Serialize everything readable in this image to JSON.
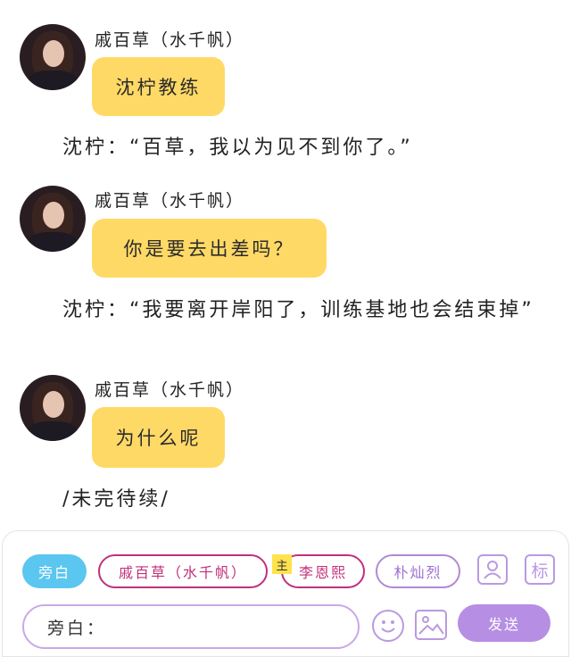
{
  "messages": [
    {
      "type": "chat",
      "speaker": "戚百草（水千帆）",
      "text": "沈柠教练"
    },
    {
      "type": "narration",
      "text": "沈柠：“百草，我以为见不到你了。”"
    },
    {
      "type": "chat",
      "speaker": "戚百草（水千帆）",
      "text": "你是要去出差吗？"
    },
    {
      "type": "narration",
      "text": "沈柠：“我要离开岸阳了，训练基地也会结束掉”"
    },
    {
      "type": "chat",
      "speaker": "戚百草（水千帆）",
      "text": "为什么呢"
    },
    {
      "type": "narration",
      "text": "/未完待续/"
    }
  ],
  "composer": {
    "roles": [
      "旁白",
      "戚百草（水千帆）",
      "李恩熙",
      "朴灿烈"
    ],
    "main_tag": "主",
    "tag_icon_label": "标",
    "input_value": "旁白：",
    "send_label": "发送",
    "selected_role_color": "#5bc6f0",
    "send_color": "#b68ee3",
    "icons": [
      "contact-card-icon",
      "tag-icon",
      "emoji-icon",
      "image-icon"
    ]
  }
}
